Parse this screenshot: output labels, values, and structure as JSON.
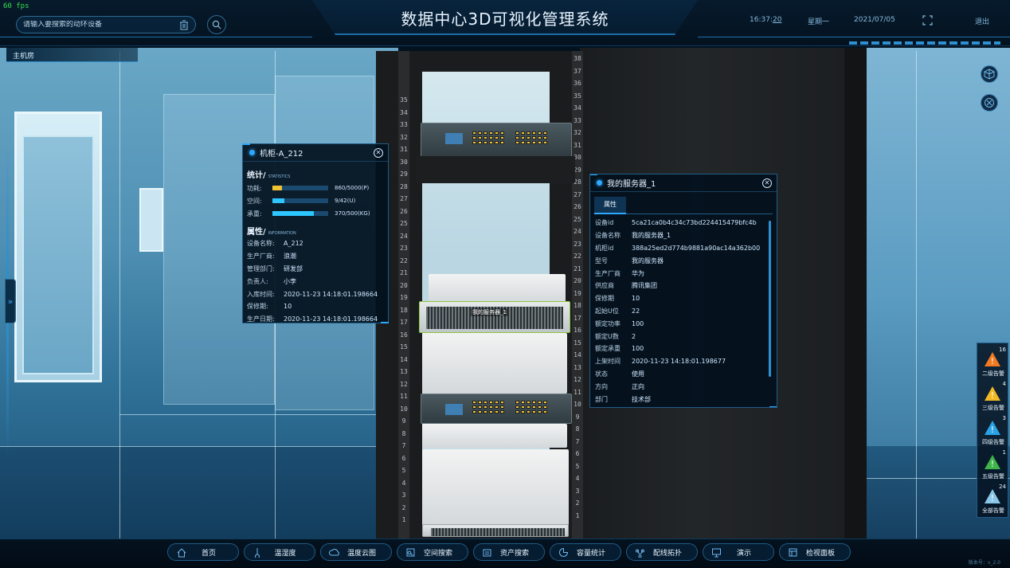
{
  "fps": "60 fps",
  "header": {
    "title": "数据中心3D可视化管理系统",
    "search_placeholder": "请输入要搜索的动环设备",
    "time": "16:37",
    "time_seconds": "20",
    "weekday": "星期一",
    "date": "2021/07/05",
    "logout": "退出"
  },
  "room_tab": "主机房",
  "cabinet_panel": {
    "title": "机柜-A_212",
    "stats_title": "统计/",
    "stats_sub": "STATISTICS",
    "stats": [
      {
        "label": "功耗:",
        "value": "860/5000(P)",
        "fraction": 0.17,
        "color": "#f1c232"
      },
      {
        "label": "空间:",
        "value": "9/42(U)",
        "fraction": 0.21,
        "color": "#2ec6ff"
      },
      {
        "label": "承重:",
        "value": "370/500(KG)",
        "fraction": 0.74,
        "color": "#2ec6ff"
      }
    ],
    "info_title": "属性/",
    "info_sub": "INFORMATION",
    "info": [
      {
        "k": "设备名称:",
        "v": "A_212"
      },
      {
        "k": "生产厂商:",
        "v": "浪潮"
      },
      {
        "k": "管理部门:",
        "v": "研发部"
      },
      {
        "k": "负责人:",
        "v": "小李"
      },
      {
        "k": "入库时间:",
        "v": "2020-11-23 14:18:01.198664"
      },
      {
        "k": "保修期:",
        "v": "10"
      },
      {
        "k": "生产日期:",
        "v": "2020-11-23 14:18:01.198664"
      }
    ]
  },
  "server_panel": {
    "title": "我的服务器_1",
    "tab": "属性",
    "rows": [
      {
        "k": "设备id",
        "v": "5ca21ca0b4c34c73bd224415479bfc4b"
      },
      {
        "k": "设备名称",
        "v": "我的服务器_1"
      },
      {
        "k": "机柜id",
        "v": "388a25ed2d774b9881a90ac14a362b00"
      },
      {
        "k": "型号",
        "v": "我的服务器"
      },
      {
        "k": "生产厂商",
        "v": "华为"
      },
      {
        "k": "供应商",
        "v": "腾讯集团"
      },
      {
        "k": "保修期",
        "v": "10"
      },
      {
        "k": "起始U位",
        "v": "22"
      },
      {
        "k": "额定功率",
        "v": "100"
      },
      {
        "k": "额定U数",
        "v": "2"
      },
      {
        "k": "额定承重",
        "v": "100"
      },
      {
        "k": "上架时间",
        "v": "2020-11-23 14:18:01.198677"
      },
      {
        "k": "状态",
        "v": "使用"
      },
      {
        "k": "方向",
        "v": "正向"
      },
      {
        "k": "部门",
        "v": "技术部"
      }
    ]
  },
  "rack_label": "我的服务器_1",
  "u_left": [
    "35",
    "34",
    "33",
    "32",
    "31",
    "30",
    "29",
    "28",
    "27",
    "26",
    "25",
    "24",
    "23",
    "22",
    "21",
    "20",
    "19",
    "18",
    "17",
    "16",
    "15",
    "14",
    "13",
    "12",
    "11",
    "10",
    "9",
    "8",
    "7",
    "6",
    "5",
    "4",
    "3",
    "2",
    "1"
  ],
  "u_right": [
    "38",
    "37",
    "36",
    "35",
    "34",
    "33",
    "32",
    "31",
    "30",
    "29",
    "28",
    "27",
    "26",
    "25",
    "24",
    "23",
    "22",
    "21",
    "20",
    "19",
    "18",
    "17",
    "16",
    "15",
    "14",
    "13",
    "12",
    "11",
    "10",
    "9",
    "8",
    "7",
    "6",
    "5",
    "4",
    "3",
    "2",
    "1"
  ],
  "alarms": [
    {
      "count": "16",
      "label": "二级告警",
      "color": "#f07a22"
    },
    {
      "count": "4",
      "label": "三级告警",
      "color": "#f1b823"
    },
    {
      "count": "3",
      "label": "四级告警",
      "color": "#2aa3e6"
    },
    {
      "count": "1",
      "label": "五级告警",
      "color": "#3fb44a"
    },
    {
      "count": "24",
      "label": "全部告警",
      "color": "#8ac6e8"
    }
  ],
  "nav": [
    {
      "label": "首页",
      "icon": "home-icon"
    },
    {
      "label": "温湿度",
      "icon": "thermometer-icon"
    },
    {
      "label": "温度云图",
      "icon": "cloud-icon"
    },
    {
      "label": "空间搜索",
      "icon": "search-box-icon"
    },
    {
      "label": "资产搜索",
      "icon": "asset-icon"
    },
    {
      "label": "容量统计",
      "icon": "pie-icon"
    },
    {
      "label": "配线拓扑",
      "icon": "topology-icon"
    },
    {
      "label": "演示",
      "icon": "presentation-icon"
    },
    {
      "label": "检视面板",
      "icon": "panel-icon"
    }
  ],
  "version": "版本号：v_2.0"
}
